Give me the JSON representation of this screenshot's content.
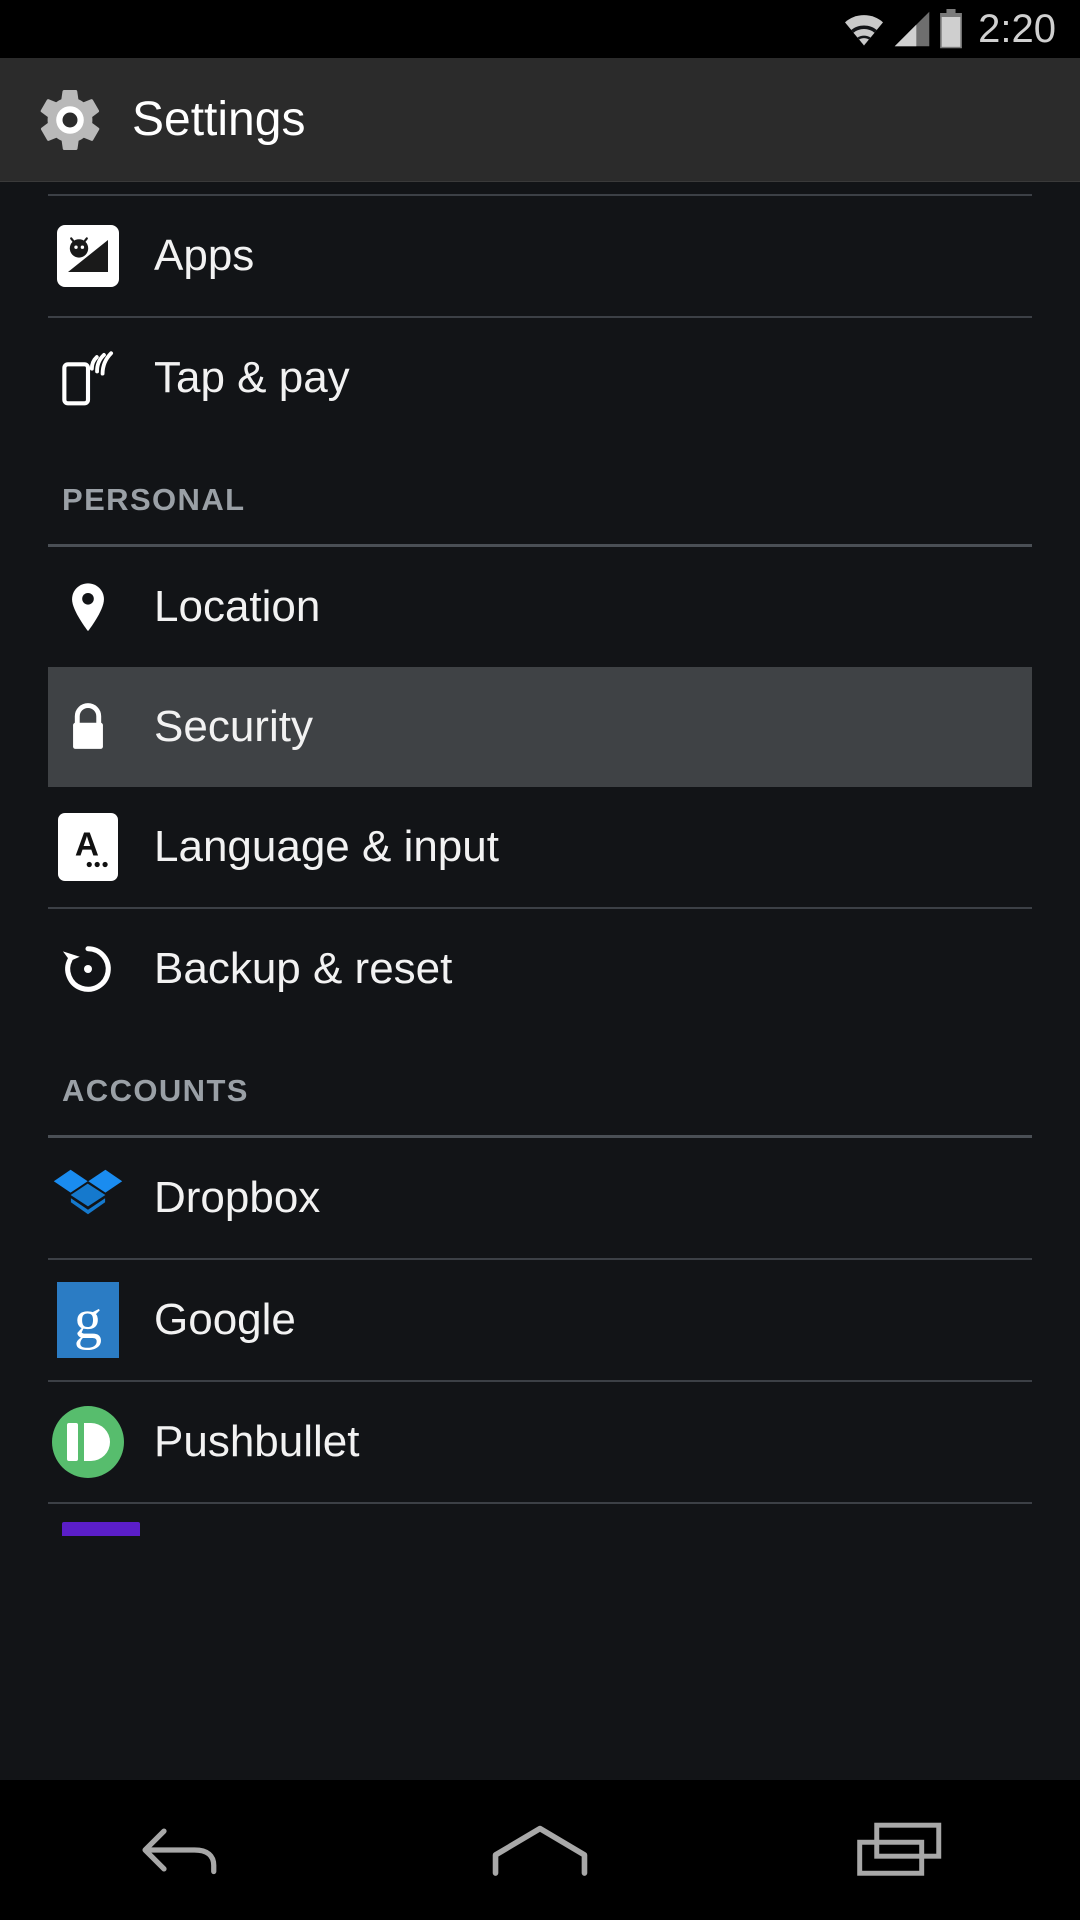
{
  "status_bar": {
    "time": "2:20",
    "icons": [
      "wifi-icon",
      "cellular-signal-icon",
      "battery-icon"
    ]
  },
  "header": {
    "title": "Settings",
    "icon": "gear-icon"
  },
  "colors": {
    "background": "#121417",
    "header_background": "#2b2b2b",
    "selected_row": "#3f4245",
    "divider": "#3c4046",
    "section_label": "#9aa0a6",
    "dropbox_blue": "#1e8ae8",
    "google_blue": "#2b7cc4",
    "pushbullet_green": "#57bd6d",
    "purple_accent": "#5b1ec9"
  },
  "list": {
    "items": [
      {
        "label": "Apps",
        "icon": "android-apps-icon",
        "selected": false,
        "type": "item"
      },
      {
        "label": "Tap & pay",
        "icon": "nfc-tap-pay-icon",
        "selected": false,
        "type": "item"
      },
      {
        "label": "PERSONAL",
        "type": "section"
      },
      {
        "label": "Location",
        "icon": "location-pin-icon",
        "selected": false,
        "type": "item"
      },
      {
        "label": "Security",
        "icon": "lock-icon",
        "selected": true,
        "type": "item"
      },
      {
        "label": "Language & input",
        "icon": "language-input-icon",
        "selected": false,
        "type": "item"
      },
      {
        "label": "Backup & reset",
        "icon": "restore-icon",
        "selected": false,
        "type": "item"
      },
      {
        "label": "ACCOUNTS",
        "type": "section"
      },
      {
        "label": "Dropbox",
        "icon": "dropbox-icon",
        "selected": false,
        "type": "item"
      },
      {
        "label": "Google",
        "icon": "google-icon",
        "selected": false,
        "type": "item"
      },
      {
        "label": "Pushbullet",
        "icon": "pushbullet-icon",
        "selected": false,
        "type": "item"
      }
    ]
  },
  "nav_bar": {
    "buttons": [
      {
        "name": "back-button",
        "icon": "back-arrow-icon"
      },
      {
        "name": "home-button",
        "icon": "home-icon"
      },
      {
        "name": "recents-button",
        "icon": "recents-icon"
      }
    ]
  }
}
